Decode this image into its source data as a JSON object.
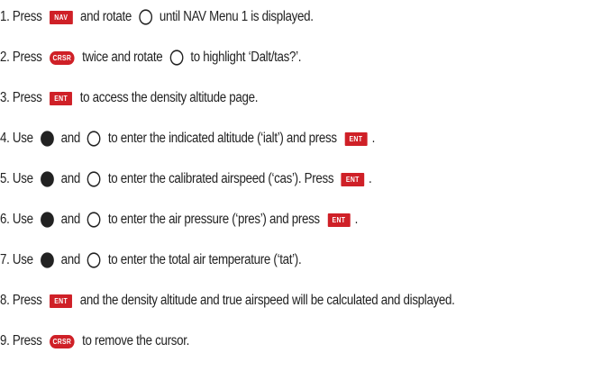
{
  "steps": [
    {
      "parts": [
        {
          "t": "text",
          "v": "1. Press "
        },
        {
          "t": "btn",
          "v": "NAV",
          "icon": "nav-button"
        },
        {
          "t": "text",
          "v": " and rotate "
        },
        {
          "t": "knob",
          "icon": "outer-knob-icon"
        },
        {
          "t": "text",
          "v": " until NAV Menu 1 is displayed."
        }
      ]
    },
    {
      "parts": [
        {
          "t": "text",
          "v": "2. Press "
        },
        {
          "t": "oval",
          "v": "CRSR",
          "icon": "crsr-button"
        },
        {
          "t": "text",
          "v": " twice and rotate "
        },
        {
          "t": "knob",
          "icon": "outer-knob-icon"
        },
        {
          "t": "text",
          "v": " to highlight ‘Dalt/tas?’."
        }
      ]
    },
    {
      "parts": [
        {
          "t": "text",
          "v": "3. Press "
        },
        {
          "t": "btn",
          "v": "ENT",
          "icon": "ent-button"
        },
        {
          "t": "text",
          "v": " to access the density altitude page."
        }
      ]
    },
    {
      "parts": [
        {
          "t": "text",
          "v": "4. Use "
        },
        {
          "t": "knobfill",
          "icon": "inner-knob-icon"
        },
        {
          "t": "text",
          "v": " and "
        },
        {
          "t": "knob",
          "icon": "outer-knob-icon"
        },
        {
          "t": "text",
          "v": " to enter the indicated altitude (‘ialt’) and press "
        },
        {
          "t": "btn",
          "v": "ENT",
          "icon": "ent-button"
        },
        {
          "t": "text",
          "v": "."
        }
      ]
    },
    {
      "parts": [
        {
          "t": "text",
          "v": "5. Use "
        },
        {
          "t": "knobfill",
          "icon": "inner-knob-icon"
        },
        {
          "t": "text",
          "v": " and "
        },
        {
          "t": "knob",
          "icon": "outer-knob-icon"
        },
        {
          "t": "text",
          "v": " to enter the calibrated airspeed (‘cas’). Press "
        },
        {
          "t": "btn",
          "v": "ENT",
          "icon": "ent-button"
        },
        {
          "t": "text",
          "v": "."
        }
      ]
    },
    {
      "parts": [
        {
          "t": "text",
          "v": "6. Use "
        },
        {
          "t": "knobfill",
          "icon": "inner-knob-icon"
        },
        {
          "t": "text",
          "v": " and "
        },
        {
          "t": "knob",
          "icon": "outer-knob-icon"
        },
        {
          "t": "text",
          "v": " to enter the air pressure (‘pres’) and press "
        },
        {
          "t": "btn",
          "v": "ENT",
          "icon": "ent-button"
        },
        {
          "t": "text",
          "v": "."
        }
      ]
    },
    {
      "parts": [
        {
          "t": "text",
          "v": "7. Use "
        },
        {
          "t": "knobfill",
          "icon": "inner-knob-icon"
        },
        {
          "t": "text",
          "v": " and "
        },
        {
          "t": "knob",
          "icon": "outer-knob-icon"
        },
        {
          "t": "text",
          "v": " to enter the total air temperature (‘tat’)."
        }
      ]
    },
    {
      "parts": [
        {
          "t": "text",
          "v": "8. Press "
        },
        {
          "t": "btn",
          "v": "ENT",
          "icon": "ent-button"
        },
        {
          "t": "text",
          "v": " and the density altitude and true airspeed will be calculated and displayed."
        }
      ]
    },
    {
      "parts": [
        {
          "t": "text",
          "v": "9. Press "
        },
        {
          "t": "oval",
          "v": "CRSR",
          "icon": "crsr-button"
        },
        {
          "t": "text",
          "v": " to remove the cursor."
        }
      ]
    }
  ],
  "colors": {
    "button_red": "#cf2027",
    "text": "#222222"
  }
}
